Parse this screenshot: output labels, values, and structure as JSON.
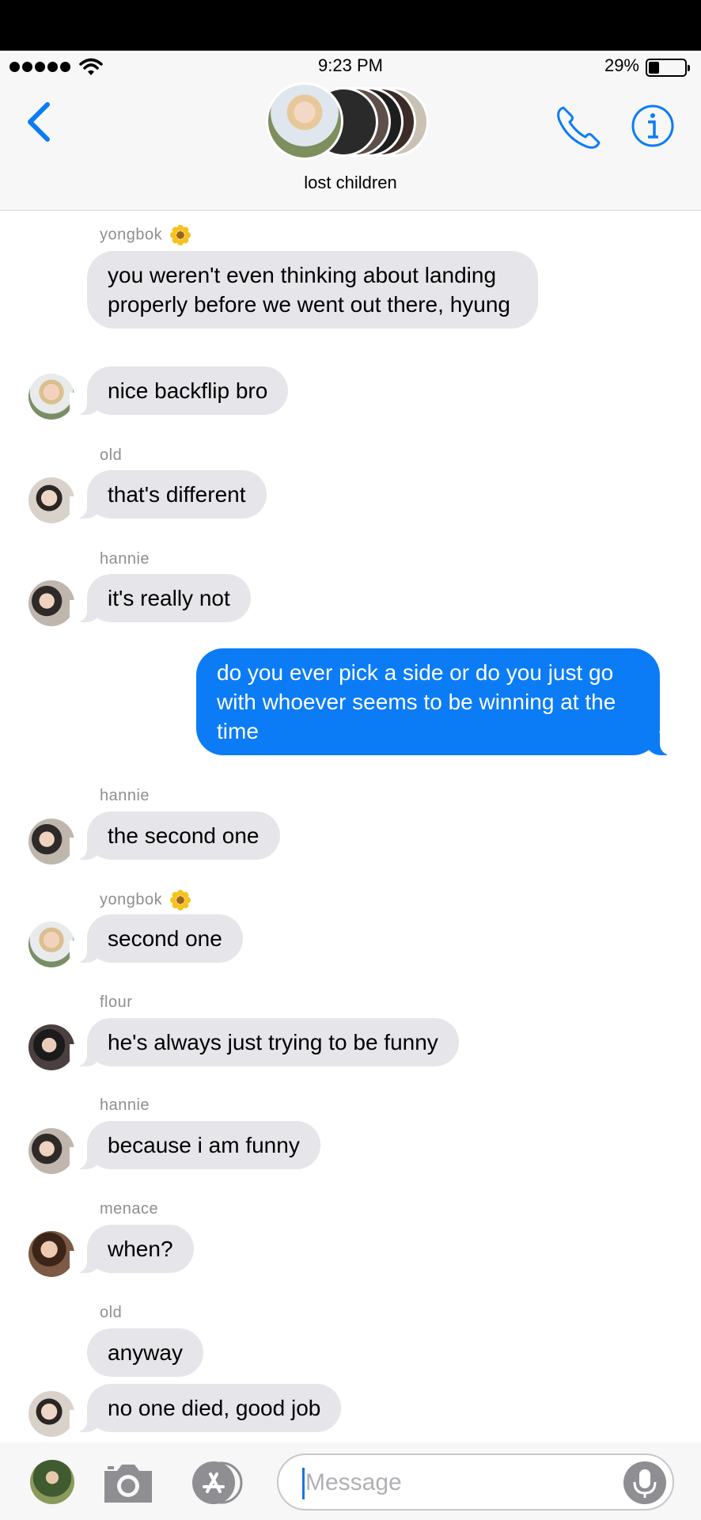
{
  "status_bar": {
    "time": "9:23 PM",
    "battery_percent": "29%",
    "battery_level": 0.29
  },
  "conversation": {
    "title": "lost children"
  },
  "messages": [
    {
      "sender": "yongbok",
      "text": "you weren't even thinking about landing properly before we went out there, hyung"
    },
    {
      "text": "nice backflip bro"
    },
    {
      "sender": "old",
      "text": "that's different"
    },
    {
      "sender": "hannie",
      "text": "it's really not"
    },
    {
      "text": "do you ever pick a side or do you just go with whoever seems to be winning at the time"
    },
    {
      "sender": "hannie",
      "text": "the second one"
    },
    {
      "sender": "yongbok",
      "text": "second one"
    },
    {
      "sender": "flour",
      "text": "he's always just trying to be funny"
    },
    {
      "sender": "hannie",
      "text": "because i am funny"
    },
    {
      "sender": "menace",
      "text": "when?"
    },
    {
      "sender": "old",
      "text": "anyway"
    },
    {
      "text": "no one died, good job"
    }
  ],
  "composer": {
    "placeholder": "Message"
  },
  "colors": {
    "accent": "#0b7cf6",
    "incoming_bubble": "#e5e5ea",
    "sender_label": "#8e8e93"
  },
  "icons": [
    "back-chevron-icon",
    "phone-icon",
    "info-icon",
    "camera-icon",
    "app-store-icon",
    "microphone-icon",
    "sunflower-icon"
  ]
}
